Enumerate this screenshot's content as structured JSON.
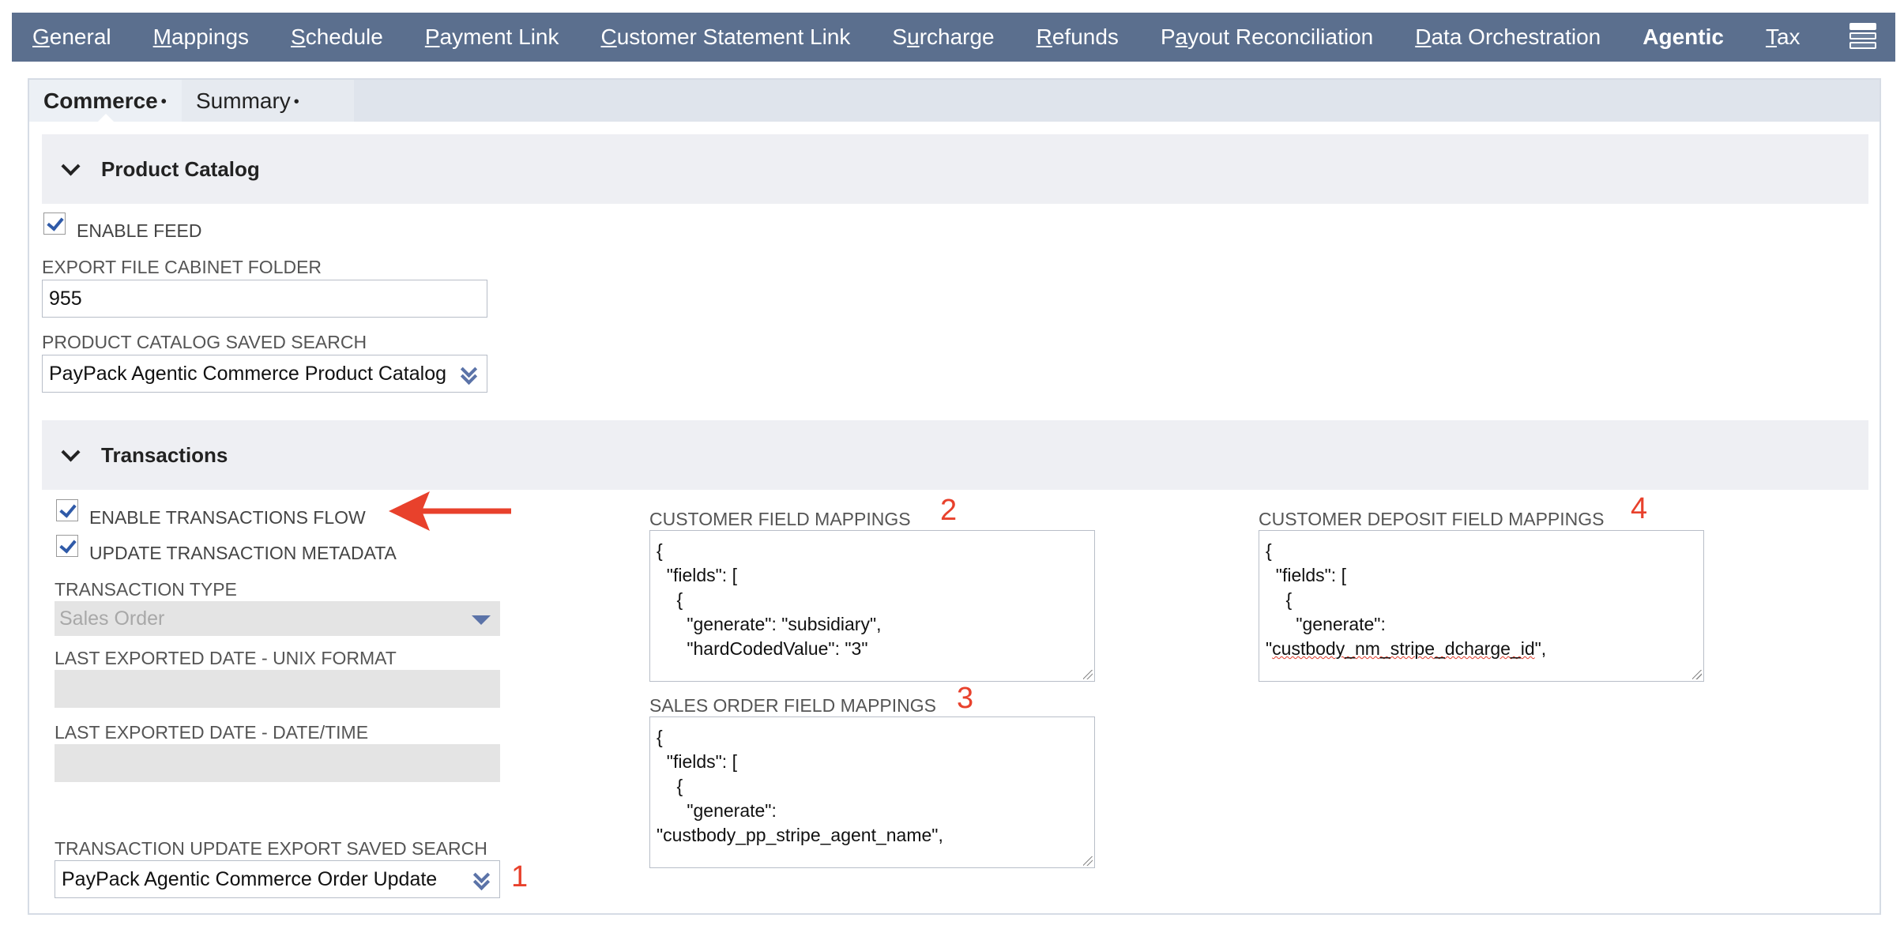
{
  "nav": {
    "items": [
      {
        "pre": "",
        "u": "G",
        "post": "eneral"
      },
      {
        "pre": "",
        "u": "M",
        "post": "appings"
      },
      {
        "pre": "",
        "u": "S",
        "post": "chedule"
      },
      {
        "pre": "",
        "u": "P",
        "post": "ayment Link"
      },
      {
        "pre": "",
        "u": "C",
        "post": "ustomer Statement Link"
      },
      {
        "pre": "S",
        "u": "u",
        "post": "rcharge"
      },
      {
        "pre": "",
        "u": "R",
        "post": "efunds"
      },
      {
        "pre": "P",
        "u": "a",
        "post": "yout Reconciliation"
      },
      {
        "pre": "",
        "u": "D",
        "post": "ata Orchestration"
      },
      {
        "pre": "A",
        "u": "g",
        "post": "entic"
      },
      {
        "pre": "",
        "u": "T",
        "post": "ax"
      }
    ],
    "active_index": 9,
    "menu_icon": "stacked-menu-icon"
  },
  "subtabs": [
    {
      "label": "Commerce",
      "dot": "•",
      "active": true
    },
    {
      "label": "Summary",
      "dot": "•",
      "active": false
    }
  ],
  "product_catalog": {
    "title": "Product Catalog",
    "enable_feed_label": "ENABLE FEED",
    "enable_feed_checked": true,
    "export_folder_label": "EXPORT FILE CABINET FOLDER",
    "export_folder_value": "955",
    "saved_search_label": "PRODUCT CATALOG SAVED SEARCH",
    "saved_search_value": "PayPack Agentic Commerce Product Catalog"
  },
  "transactions": {
    "title": "Transactions",
    "enable_flow_label": "ENABLE TRANSACTIONS FLOW",
    "enable_flow_checked": true,
    "update_metadata_label": "UPDATE TRANSACTION METADATA",
    "update_metadata_checked": true,
    "transaction_type_label": "TRANSACTION TYPE",
    "transaction_type_value": "Sales Order",
    "last_unix_label": "LAST EXPORTED DATE - UNIX FORMAT",
    "last_unix_value": "",
    "last_datetime_label": "LAST EXPORTED DATE - DATE/TIME",
    "last_datetime_value": "",
    "update_search_label": "TRANSACTION UPDATE EXPORT SAVED SEARCH",
    "update_search_value": "PayPack Agentic Commerce Order Update",
    "customer_mappings_label": "CUSTOMER FIELD MAPPINGS",
    "customer_mappings_value": "{\n  \"fields\": [\n    {\n      \"generate\": \"subsidiary\",\n      \"hardCodedValue\": \"3\"",
    "sales_order_mappings_label": "SALES ORDER FIELD MAPPINGS",
    "sales_order_mappings_value_pre": "{\n  \"fields\": [\n    {\n      \"generate\":\n\"custbody_pp_stripe_agent_name\",",
    "deposit_mappings_label": "CUSTOMER DEPOSIT FIELD MAPPINGS",
    "deposit_mappings_value_pre": "{\n  \"fields\": [\n    {\n      \"generate\":\n\"",
    "deposit_mappings_value_squiggle": "custbody_nm_stripe_dcharge_id",
    "deposit_mappings_value_post": "\","
  },
  "annotations": {
    "one": "1",
    "two": "2",
    "three": "3",
    "four": "4",
    "color": "#e8412c"
  }
}
